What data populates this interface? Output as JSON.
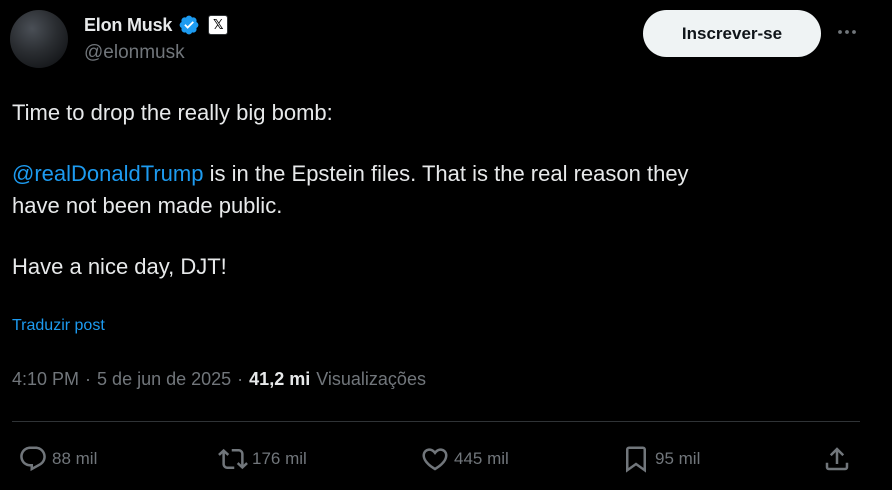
{
  "author": {
    "display_name": "Elon Musk",
    "handle": "@elonmusk",
    "verified_icon": "verified-badge-icon",
    "affiliation_icon": "x-logo-icon",
    "affiliation_glyph": "𝕏"
  },
  "header": {
    "subscribe_label": "Inscrever-se",
    "more_icon": "more-horizontal-icon"
  },
  "tweet": {
    "line1": "Time to drop the really big bomb:",
    "mention": "@realDonaldTrump",
    "line2_rest": " is in the Epstein files. That is the real reason they",
    "line3": "have not been made public.",
    "line4": "Have a nice day, DJT!"
  },
  "translate_label": "Traduzir post",
  "meta": {
    "time": "4:10 PM",
    "separator": "·",
    "date": "5 de jun de 2025",
    "views_count": "41,2 mi",
    "views_label": "Visualizações"
  },
  "actions": {
    "replies": "88 mil",
    "reposts": "176 mil",
    "likes": "445 mil",
    "bookmarks": "95 mil"
  },
  "colors": {
    "background": "#000000",
    "text": "#e7e9ea",
    "secondary": "#71767b",
    "accent": "#1d9bf0",
    "divider": "#2f3336"
  }
}
